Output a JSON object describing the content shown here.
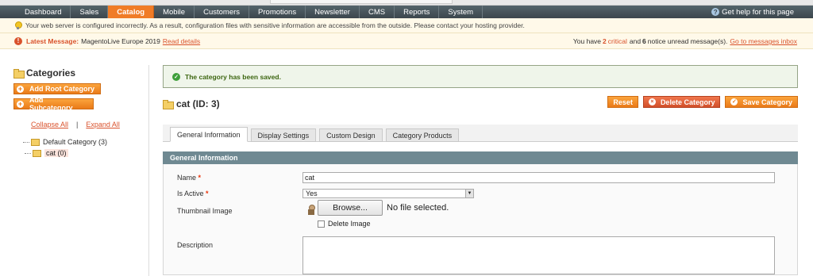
{
  "nav": {
    "items": [
      "Dashboard",
      "Sales",
      "Catalog",
      "Mobile",
      "Customers",
      "Promotions",
      "Newsletter",
      "CMS",
      "Reports",
      "System"
    ],
    "active": "Catalog",
    "help": "Get help for this page"
  },
  "notice": {
    "text": "Your web server is configured incorrectly. As a result, configuration files with sensitive information are accessible from the outside. Please contact your hosting provider."
  },
  "message": {
    "label": "Latest Message:",
    "text": "MagentoLive Europe 2019",
    "read_details": "Read details",
    "summary_prefix": "You have",
    "critical_count": "2",
    "critical_word": "critical",
    "and_word": "and",
    "notice_count": "6",
    "summary_suffix": "notice unread message(s).",
    "inbox_link": "Go to messages inbox"
  },
  "sidebar": {
    "title": "Categories",
    "add_root": "Add Root Category",
    "add_sub": "Add Subcategory",
    "collapse_all": "Collapse All",
    "separator": "|",
    "expand_all": "Expand All",
    "tree": {
      "root": "Default Category (3)",
      "child": "cat (0)"
    }
  },
  "main": {
    "success": "The category has been saved.",
    "title": "cat (ID: 3)",
    "buttons": {
      "reset": "Reset",
      "delete": "Delete Category",
      "save": "Save Category"
    },
    "tabs": [
      "General Information",
      "Display Settings",
      "Custom Design",
      "Category Products"
    ],
    "active_tab": "General Information",
    "fieldset_title": "General Information",
    "fields": {
      "name_label": "Name",
      "name_value": "cat",
      "active_label": "Is Active",
      "active_value": "Yes",
      "thumb_label": "Thumbnail Image",
      "browse": "Browse...",
      "no_file": "No file selected.",
      "delete_image": "Delete Image",
      "description_label": "Description",
      "required_mark": "*"
    }
  },
  "colors": {
    "nav_bg": "#3c474d",
    "nav_active": "#f07c27",
    "button_orange": "#ea7a19",
    "critical": "#d9522c",
    "success_text": "#3d6611",
    "fieldset_head": "#6f8992"
  }
}
